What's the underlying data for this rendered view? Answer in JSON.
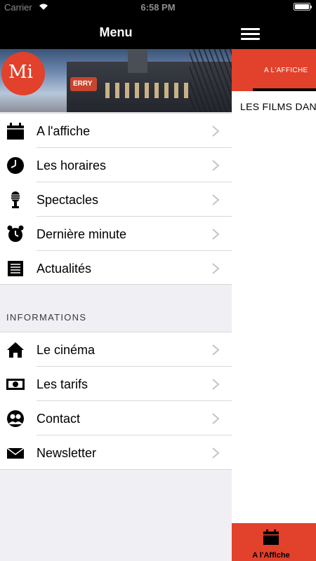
{
  "status_bar": {
    "carrier": "Carrier",
    "time": "6:58 PM"
  },
  "menu": {
    "title": "Menu"
  },
  "banner": {
    "logo_text": "Mi",
    "sign_text": "ERRY"
  },
  "main_items": [
    {
      "label": "A l'affiche",
      "icon": "calendar-icon"
    },
    {
      "label": "Les horaires",
      "icon": "clock-icon"
    },
    {
      "label": "Spectacles",
      "icon": "microphone-icon"
    },
    {
      "label": "Dernière minute",
      "icon": "alarm-clock-icon"
    },
    {
      "label": "Actualités",
      "icon": "news-icon"
    }
  ],
  "informations": {
    "header": "INFORMATIONS",
    "items": [
      {
        "label": "Le cinéma",
        "icon": "home-icon"
      },
      {
        "label": "Les tarifs",
        "icon": "money-icon"
      },
      {
        "label": "Contact",
        "icon": "contact-icon"
      },
      {
        "label": "Newsletter",
        "icon": "envelope-icon"
      }
    ]
  },
  "right_panel": {
    "tab_label": "A L'AFFICHE",
    "content_text": "LES FILMS DAN",
    "bottom_tab_label": "A l'Affiche"
  },
  "colors": {
    "accent": "#e2412b",
    "header": "#000000",
    "background": "#efeff4"
  }
}
